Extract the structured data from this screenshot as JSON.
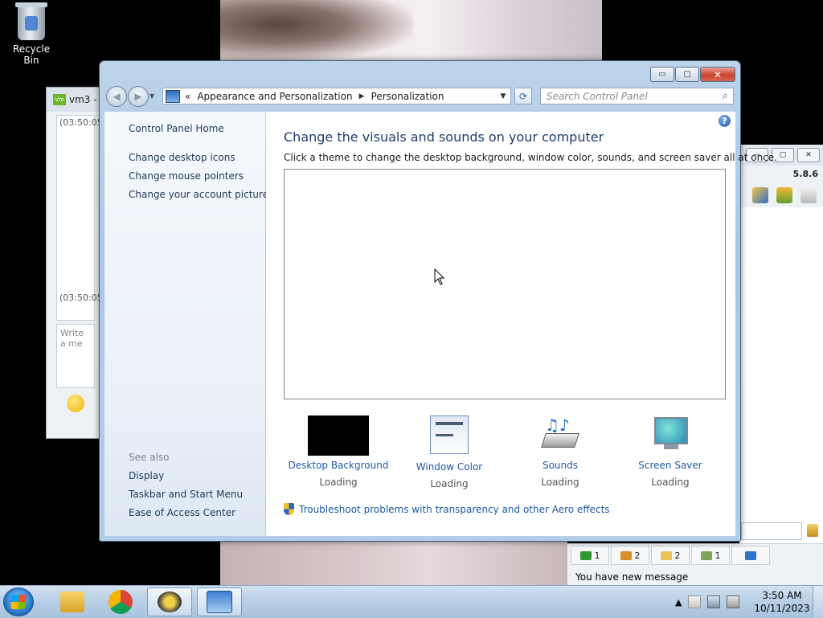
{
  "desktop": {
    "recycle_bin_label": "Recycle Bin"
  },
  "vm3_window": {
    "title": "vm3 -",
    "log_line_1": "(03:50:05",
    "log_line_2": "(03:50:05",
    "write_placeholder": "Write a me"
  },
  "right_app": {
    "version": "5.8.6",
    "status_tabs": [
      {
        "count": "1",
        "icon": "green-monitor-icon"
      },
      {
        "count": "2",
        "icon": "contacts-icon"
      },
      {
        "count": "2",
        "icon": "group-icon"
      },
      {
        "count": "1",
        "icon": "users-icon"
      },
      {
        "count": "",
        "icon": "flag-icon"
      }
    ],
    "message": "You have new message"
  },
  "window": {
    "breadcrumb_prefix": "«",
    "breadcrumb": [
      "Appearance and Personalization",
      "Personalization"
    ],
    "search_placeholder": "Search Control Panel",
    "caption": {
      "minimize": "▭",
      "maximize": "▢",
      "close": "✕"
    }
  },
  "left_pane": {
    "home": "Control Panel Home",
    "links": [
      "Change desktop icons",
      "Change mouse pointers",
      "Change your account picture"
    ],
    "see_also_label": "See also",
    "see_also": [
      "Display",
      "Taskbar and Start Menu",
      "Ease of Access Center"
    ]
  },
  "content": {
    "heading": "Change the visuals and sounds on your computer",
    "subheading": "Click a theme to change the desktop background, window color, sounds, and screen saver all at once.",
    "options": [
      {
        "label": "Desktop Background",
        "status": "Loading",
        "icon": "desktop-background-icon"
      },
      {
        "label": "Window Color",
        "status": "Loading",
        "icon": "window-color-icon"
      },
      {
        "label": "Sounds",
        "status": "Loading",
        "icon": "sounds-icon"
      },
      {
        "label": "Screen Saver",
        "status": "Loading",
        "icon": "screen-saver-icon"
      }
    ],
    "troubleshoot": "Troubleshoot problems with transparency and other Aero effects"
  },
  "taskbar": {
    "apps": [
      "file-explorer-icon",
      "chrome-icon",
      "bee-app-icon",
      "control-panel-icon"
    ],
    "time": "3:50 AM",
    "date": "10/11/2023"
  }
}
